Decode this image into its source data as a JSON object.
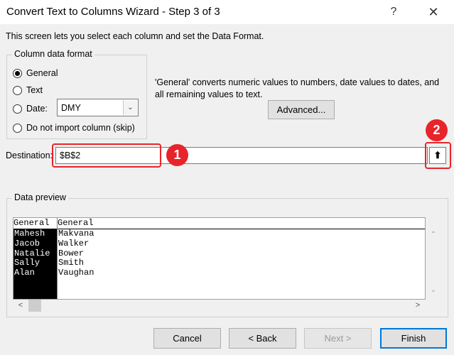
{
  "window": {
    "title": "Convert Text to Columns Wizard - Step 3 of 3",
    "help_label": "?",
    "close_label": "✕"
  },
  "instruction": "This screen lets you select each column and set the Data Format.",
  "format_group": {
    "label": "Column data format",
    "options": [
      {
        "label": "General",
        "checked": true
      },
      {
        "label": "Text",
        "checked": false
      },
      {
        "label": "Date:",
        "checked": false
      },
      {
        "label": "Do not import column (skip)",
        "checked": false
      }
    ],
    "date_select": {
      "value": "DMY",
      "arrow": "⌄"
    }
  },
  "description": "'General' converts numeric values to numbers, date values to dates, and all remaining values to text.",
  "advanced_button": "Advanced...",
  "destination": {
    "label": "Destination:",
    "value": "$B$2",
    "collapse_icon": "⬆"
  },
  "annotations": {
    "badge1": "1",
    "badge2": "2"
  },
  "preview": {
    "label": "Data preview",
    "headers": [
      "General",
      "General"
    ],
    "rows": [
      [
        "Mahesh",
        "Makvana"
      ],
      [
        "Jacob",
        "Walker"
      ],
      [
        "Natalie",
        "Bower"
      ],
      [
        "Sally",
        "Smith"
      ],
      [
        "Alan",
        "Vaughan"
      ]
    ],
    "scroll_up": "⌃",
    "scroll_down": "⌄",
    "scroll_left": "<",
    "scroll_right": ">"
  },
  "footer": {
    "cancel": "Cancel",
    "back": "< Back",
    "next": "Next >",
    "finish": "Finish"
  }
}
